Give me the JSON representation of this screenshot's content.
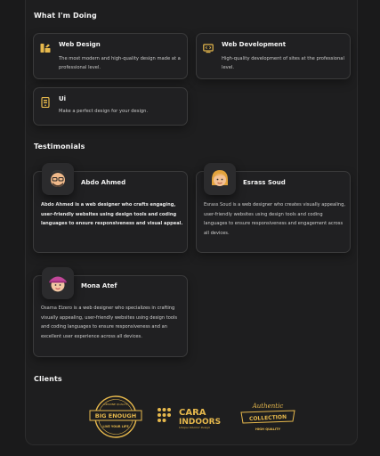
{
  "services_section": {
    "heading": "What I'm Doing",
    "items": [
      {
        "title": "Web Design",
        "text": "The most modern and high-quality design made at a professional level.",
        "icon": "design-icon"
      },
      {
        "title": "Web Development",
        "text": "High-quality development of sites at the professional level.",
        "icon": "code-icon"
      },
      {
        "title": "Ui",
        "text": "Make a perfect design for your design.",
        "icon": "mobile-icon"
      }
    ]
  },
  "testimonials_section": {
    "heading": "Testimonials",
    "items": [
      {
        "name": "Abdo Ahmed",
        "text": "Abdo Ahmed is a web designer who crafts engaging, user-friendly websites using design tools and coding languages to ensure responsiveness and visual appeal."
      },
      {
        "name": "Esrass Soud",
        "text": "Esrass Soud is a web designer who creates visually appealing, user-friendly websites using design tools and coding languages to ensure responsiveness and engagement across all devices."
      },
      {
        "name": "Mona Atef",
        "text": "Osama Elzero is a web designer who specializes in crafting visually appealing, user-friendly websites using design tools and coding languages to ensure responsiveness and an excellent user experience across all devices."
      }
    ]
  },
  "clients_section": {
    "heading": "Clients",
    "logos": [
      {
        "top": "BIG ENOUGH",
        "sub": "LIVE YOUR LIFE",
        "ring": "GENUINE QUALITY"
      },
      {
        "line1": "CARA",
        "line2": "INDOORS",
        "sub": "Unique Interior Design"
      },
      {
        "script": "Authentic",
        "band": "COLLECTION",
        "sub": "HIGH QUALITY"
      }
    ]
  },
  "colors": {
    "accent": "#e6b84c",
    "background": "#1a1a1b",
    "card": "#202022"
  }
}
